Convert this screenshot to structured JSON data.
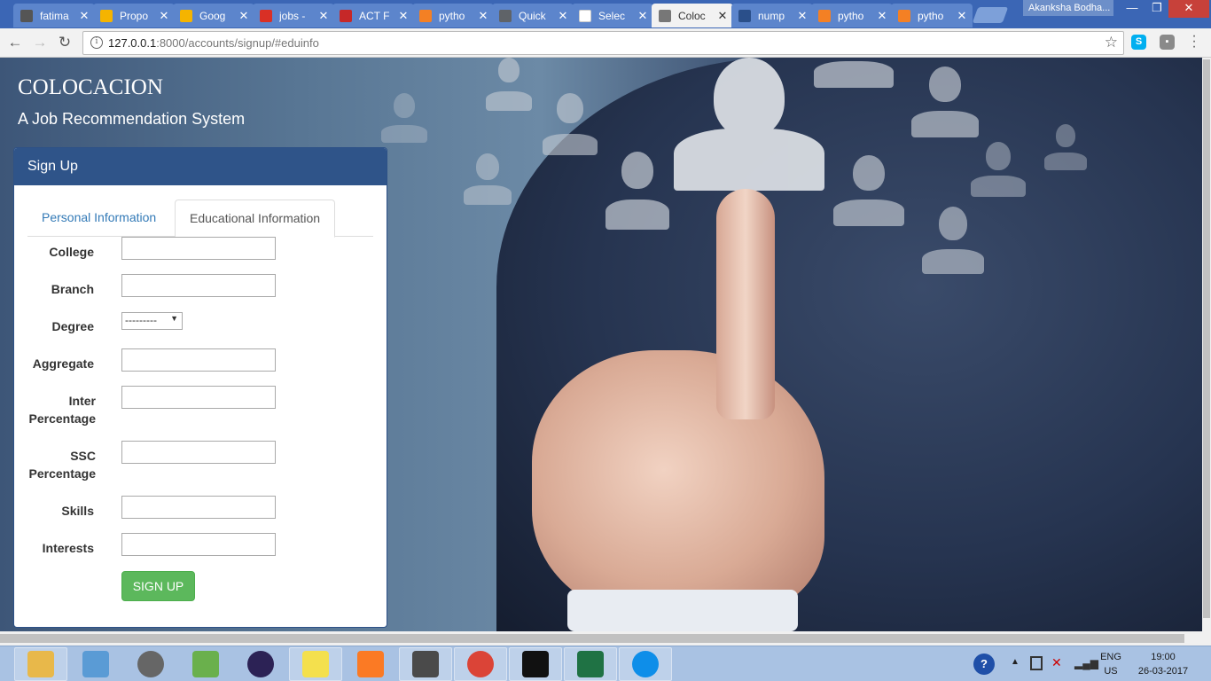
{
  "browser": {
    "tabs": [
      {
        "label": "fatima",
        "icon": "hash-icon",
        "color": "#555555"
      },
      {
        "label": "Propo",
        "icon": "google-drive-icon",
        "color": "#f5b400"
      },
      {
        "label": "Goog",
        "icon": "google-drive-icon",
        "color": "#f5b400"
      },
      {
        "label": "jobs -",
        "icon": "gmail-icon",
        "color": "#d93025"
      },
      {
        "label": "ACT F",
        "icon": "act-icon",
        "color": "#c62828"
      },
      {
        "label": "pytho",
        "icon": "stackoverflow-icon",
        "color": "#f48024"
      },
      {
        "label": "Quick",
        "icon": "chart-icon",
        "color": "#5f6368"
      },
      {
        "label": "Selec",
        "icon": "document-icon",
        "color": "#ffffff"
      },
      {
        "label": "Coloc",
        "icon": "document-icon",
        "color": "#777777"
      },
      {
        "label": "nump",
        "icon": "scipy-icon",
        "color": "#2a4f8a"
      },
      {
        "label": "pytho",
        "icon": "stackoverflow-icon",
        "color": "#f48024"
      },
      {
        "label": "pytho",
        "icon": "stackoverflow-icon",
        "color": "#f48024"
      }
    ],
    "tab_close": "✕",
    "profile_name": "Akanksha Bodha...",
    "url_host": "127.0.0.1",
    "url_rest": ":8000/accounts/signup/#eduinfo"
  },
  "page": {
    "brand": "COLOCACION",
    "tagline": "A Job Recommendation System",
    "panel_title": "Sign Up",
    "tabs": [
      {
        "label": "Personal Information",
        "active": false
      },
      {
        "label": "Educational Information",
        "active": true
      }
    ],
    "form": {
      "college_label": "College",
      "branch_label": "Branch",
      "degree_label": "Degree",
      "degree_value": "---------",
      "aggregate_label": "Aggregate",
      "inter_label_1": "Inter",
      "inter_label_2": "Percentage",
      "ssc_label_1": "SSC",
      "ssc_label_2": "Percentage",
      "skills_label": "Skills",
      "interests_label": "Interests",
      "submit_label": "SIGN UP"
    }
  },
  "taskbar": {
    "apps": [
      {
        "name": "file-explorer-icon",
        "color": "#e8b84a"
      },
      {
        "name": "notes-app-icon",
        "color": "#5a9bd5"
      },
      {
        "name": "recovery-app-icon",
        "color": "#666666"
      },
      {
        "name": "notepad-plus-icon",
        "color": "#6ab04c"
      },
      {
        "name": "eclipse-icon",
        "color": "#2c2255"
      },
      {
        "name": "sticky-notes-icon",
        "color": "#f4e04d"
      },
      {
        "name": "xampp-icon",
        "color": "#fb7a24"
      },
      {
        "name": "sublime-text-icon",
        "color": "#4a4a4a"
      },
      {
        "name": "chrome-icon",
        "color": "#db4437"
      },
      {
        "name": "command-prompt-icon",
        "color": "#111111"
      },
      {
        "name": "excel-icon",
        "color": "#1f7244"
      },
      {
        "name": "teamviewer-icon",
        "color": "#0e8ee9"
      }
    ],
    "lang_1": "ENG",
    "lang_2": "US",
    "time": "19:00",
    "date": "26-03-2017"
  }
}
